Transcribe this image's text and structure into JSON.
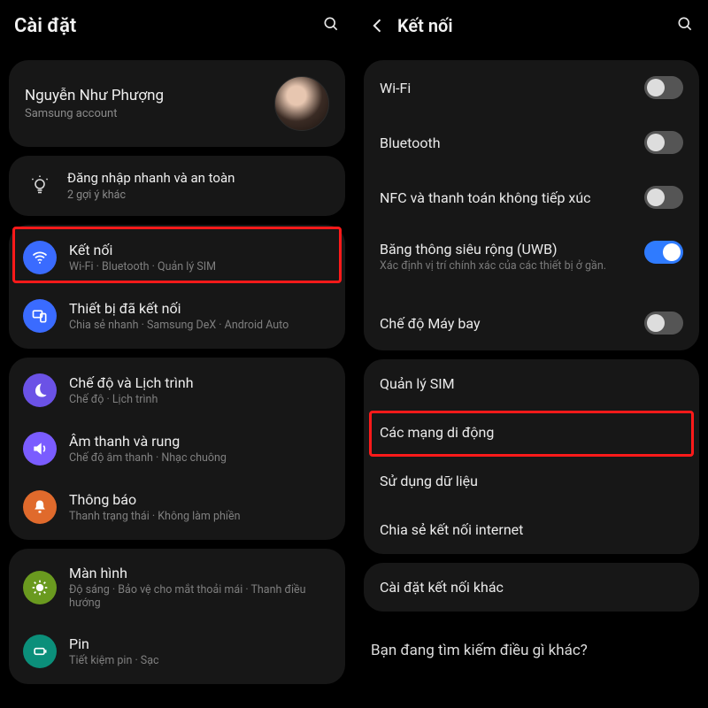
{
  "left": {
    "title": "Cài đặt",
    "account": {
      "name": "Nguyễn Như Phượng",
      "sub": "Samsung account"
    },
    "tips": {
      "title": "Đăng nhập nhanh và an toàn",
      "sub": "2 gợi ý khác"
    },
    "groups": {
      "connections": {
        "ketnoi": {
          "label": "Kết nối",
          "sub": "Wi-Fi · Bluetooth · Quản lý SIM"
        },
        "devices": {
          "label": "Thiết bị đã kết nối",
          "sub": "Chia sẻ nhanh · Samsung DeX · Android Auto"
        }
      },
      "modes": {
        "modes": {
          "label": "Chế độ và Lịch trình",
          "sub": "Chế độ · Lịch trình"
        },
        "sound": {
          "label": "Âm thanh và rung",
          "sub": "Chế độ âm thanh · Nhạc chuông"
        },
        "notif": {
          "label": "Thông báo",
          "sub": "Thanh trạng thái · Không làm phiền"
        }
      },
      "display": {
        "display": {
          "label": "Màn hình",
          "sub": "Độ sáng · Bảo vệ cho mắt thoải mái · Thanh điều hướng"
        },
        "battery": {
          "label": "Pin",
          "sub": "Tiết kiệm pin · Sạc"
        }
      }
    }
  },
  "right": {
    "title": "Kết nối",
    "group1": {
      "wifi": {
        "label": "Wi-Fi"
      },
      "bt": {
        "label": "Bluetooth"
      },
      "nfc": {
        "label": "NFC và thanh toán không tiếp xúc"
      },
      "uwb": {
        "label": "Băng thông siêu rộng (UWB)",
        "sub": "Xác định vị trí chính xác của các thiết bị ở gần."
      },
      "airplane": {
        "label": "Chế độ Máy bay"
      }
    },
    "group2": {
      "sim": {
        "label": "Quản lý SIM"
      },
      "mobile": {
        "label": "Các mạng di động"
      },
      "data": {
        "label": "Sử dụng dữ liệu"
      },
      "tether": {
        "label": "Chia sẻ kết nối internet"
      }
    },
    "group3": {
      "more": {
        "label": "Cài đặt kết nối khác"
      }
    },
    "prompt": "Bạn đang tìm kiếm điều gì khác?"
  }
}
